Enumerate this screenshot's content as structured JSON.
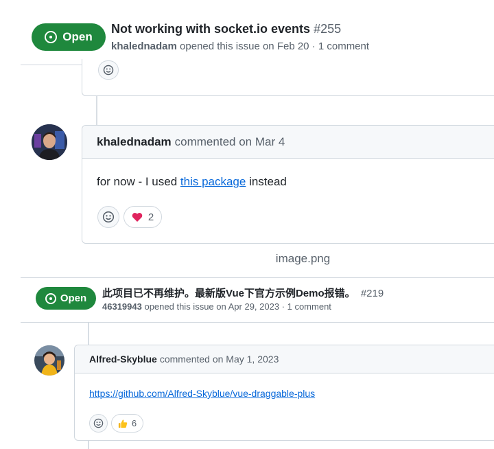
{
  "issue1": {
    "status": "Open",
    "title": "Not working with socket.io events",
    "number": "#255",
    "author": "khalednadam",
    "meta": "opened this issue on Feb 20 · 1 comment",
    "comment": {
      "author": "khalednadam",
      "action": "commented on Mar 4",
      "text_before": "for now - I used ",
      "link_text": "this package",
      "text_after": " instead",
      "reaction_emoji": "❤️",
      "reaction_count": "2"
    }
  },
  "caption": "image.png",
  "issue2": {
    "status": "Open",
    "title": "此项目已不再维护。最新版Vue下官方示例Demo报错。",
    "number": "#219",
    "author": "46319943",
    "meta": "opened this issue on Apr 29, 2023 · 1 comment",
    "comment": {
      "author": "Alfred-Skyblue",
      "action": "commented on May 1, 2023",
      "link_text": "https://github.com/Alfred-Skyblue/vue-draggable-plus",
      "reaction_emoji": "👍",
      "reaction_count": "6"
    }
  },
  "colors": {
    "open_green": "#1f883d",
    "link_blue": "#0969da",
    "border": "#d0d7de"
  },
  "icons": [
    "issue-opened-icon",
    "smiley-icon",
    "heart-icon",
    "thumbs-up-icon"
  ]
}
